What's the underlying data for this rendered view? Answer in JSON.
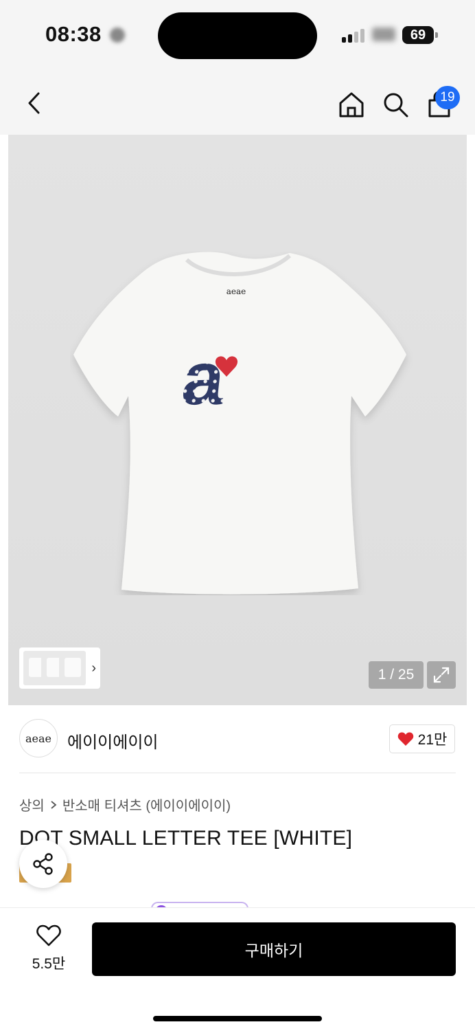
{
  "status_bar": {
    "time": "08:38",
    "battery": "69"
  },
  "nav": {
    "cart_count": "19"
  },
  "gallery": {
    "page_indicator": "1 / 25",
    "thumbnail_arrow": "›"
  },
  "brand": {
    "logo_text": "aeae",
    "name": "에이이에이이",
    "likes": "21만"
  },
  "product": {
    "breadcrumb": [
      "상의",
      "반소매 티셔츠 (에이이에이이)"
    ],
    "title": "DOT SMALL LETTER TEE [WHITE]",
    "neck_label": "aeae"
  },
  "bottom_bar": {
    "wishlist_count": "5.5만",
    "buy_label": "구매하기"
  },
  "colors": {
    "accent_blue": "#1e6cf5",
    "heart_red": "#e0262e",
    "print_navy": "#2f3a66",
    "buy_button": "#000000"
  }
}
